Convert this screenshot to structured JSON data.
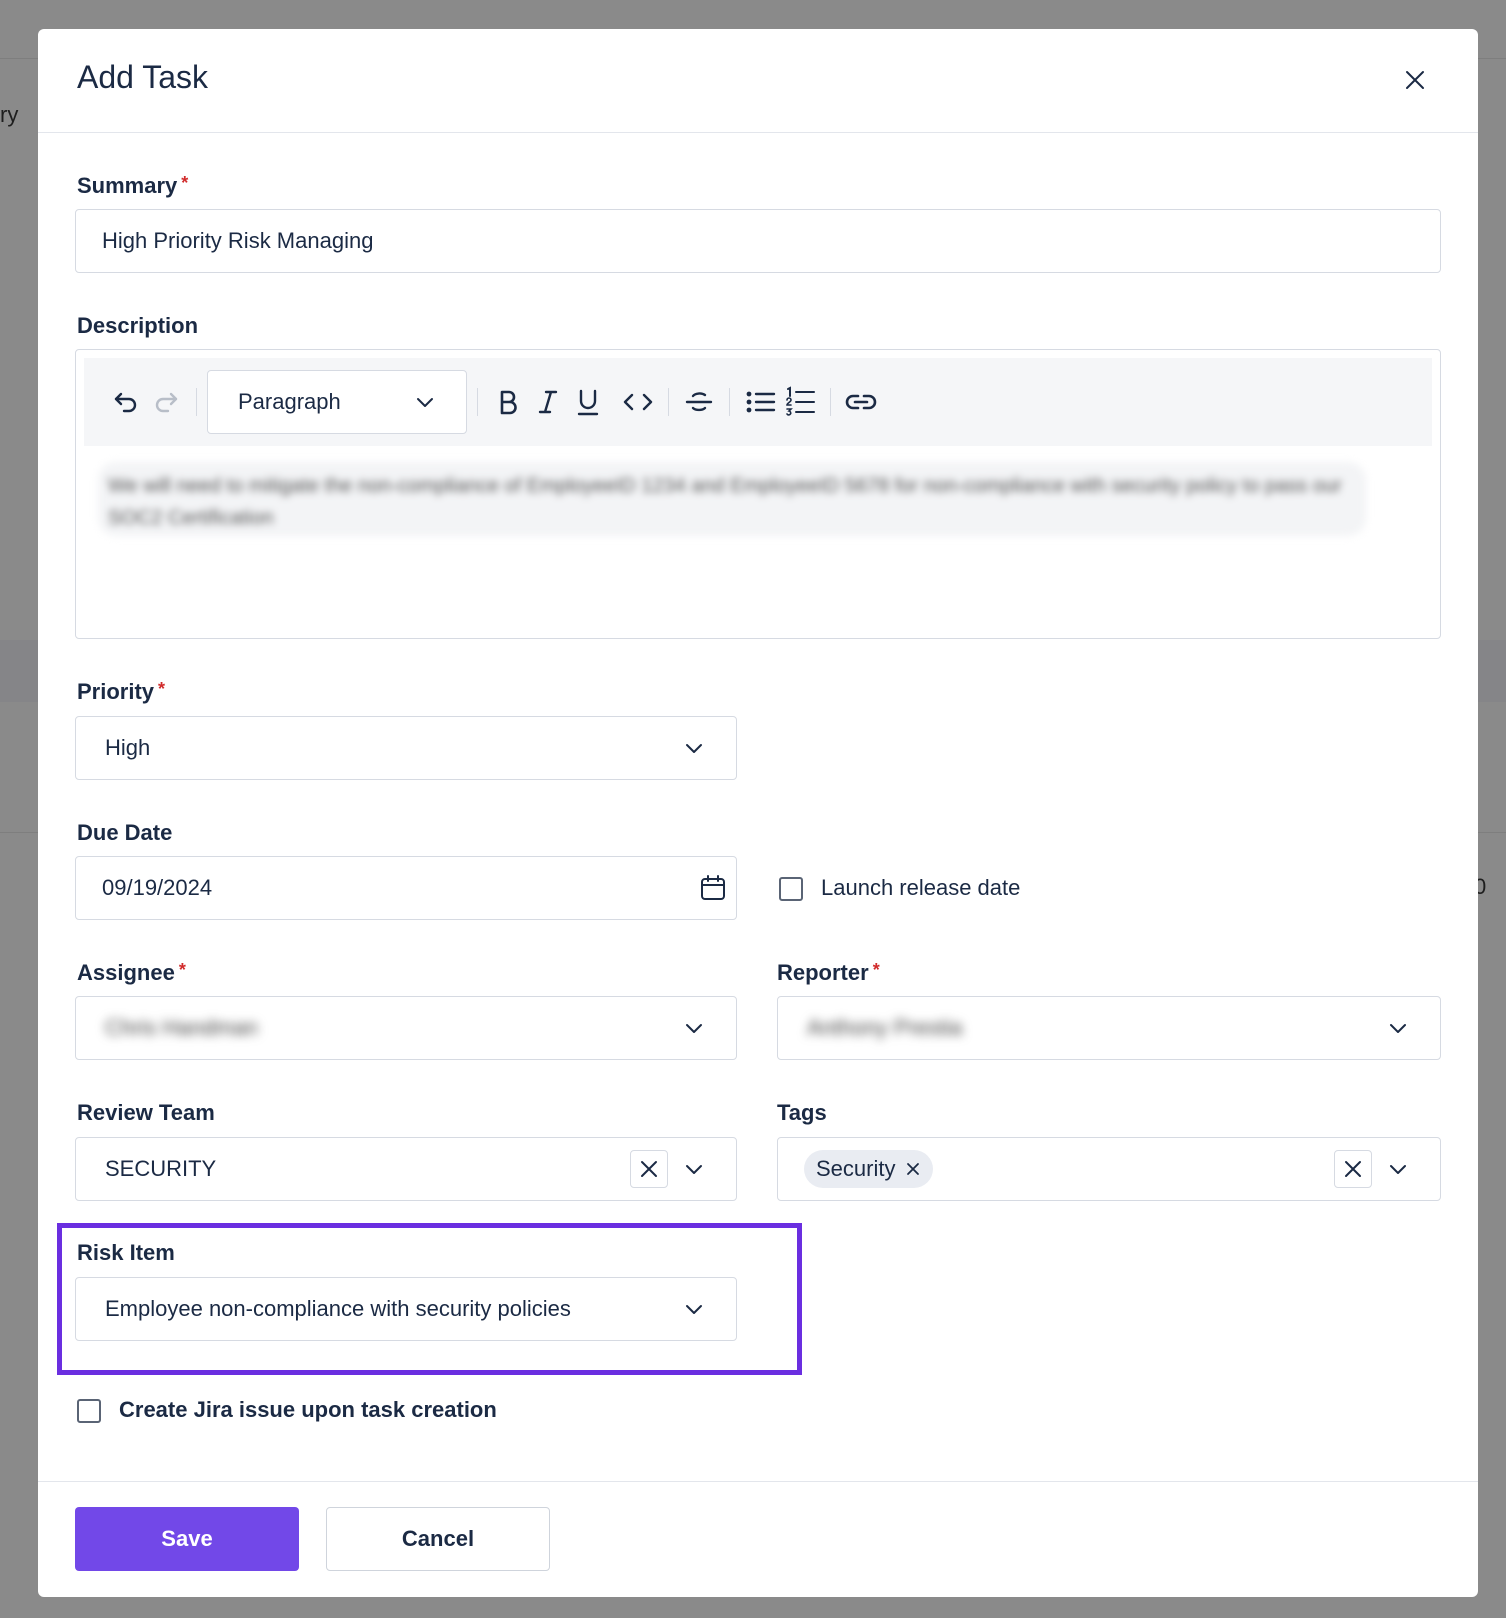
{
  "background": {
    "fragment_left": "ry",
    "fragment_right": "0"
  },
  "modal": {
    "title": "Add Task"
  },
  "summary": {
    "label": "Summary",
    "required_mark": "*",
    "value": "High Priority Risk Managing"
  },
  "description": {
    "label": "Description",
    "block_type": "Paragraph",
    "content": "We will need to mitigate the non-compliance of EmployeeID 1234 and EmployeeID 5678 for non-compliance with security policy to pass our SOC2 Certification"
  },
  "priority": {
    "label": "Priority",
    "required_mark": "*",
    "value": "High"
  },
  "due_date": {
    "label": "Due Date",
    "value": "09/19/2024",
    "launch_checkbox_label": "Launch release date"
  },
  "assignee": {
    "label": "Assignee",
    "required_mark": "*",
    "value": "Chris Handman"
  },
  "reporter": {
    "label": "Reporter",
    "required_mark": "*",
    "value": "Anthony Prestia"
  },
  "review_team": {
    "label": "Review Team",
    "value": "SECURITY"
  },
  "tags": {
    "label": "Tags",
    "chips": [
      "Security"
    ]
  },
  "risk_item": {
    "label": "Risk Item",
    "value": "Employee non-compliance with security policies"
  },
  "jira": {
    "label": "Create Jira issue upon task creation"
  },
  "footer": {
    "save_label": "Save",
    "cancel_label": "Cancel"
  },
  "colors": {
    "primary": "#7248e8",
    "highlight": "#6a2ee0",
    "required": "#d12b2b",
    "text": "#1b2a44"
  }
}
